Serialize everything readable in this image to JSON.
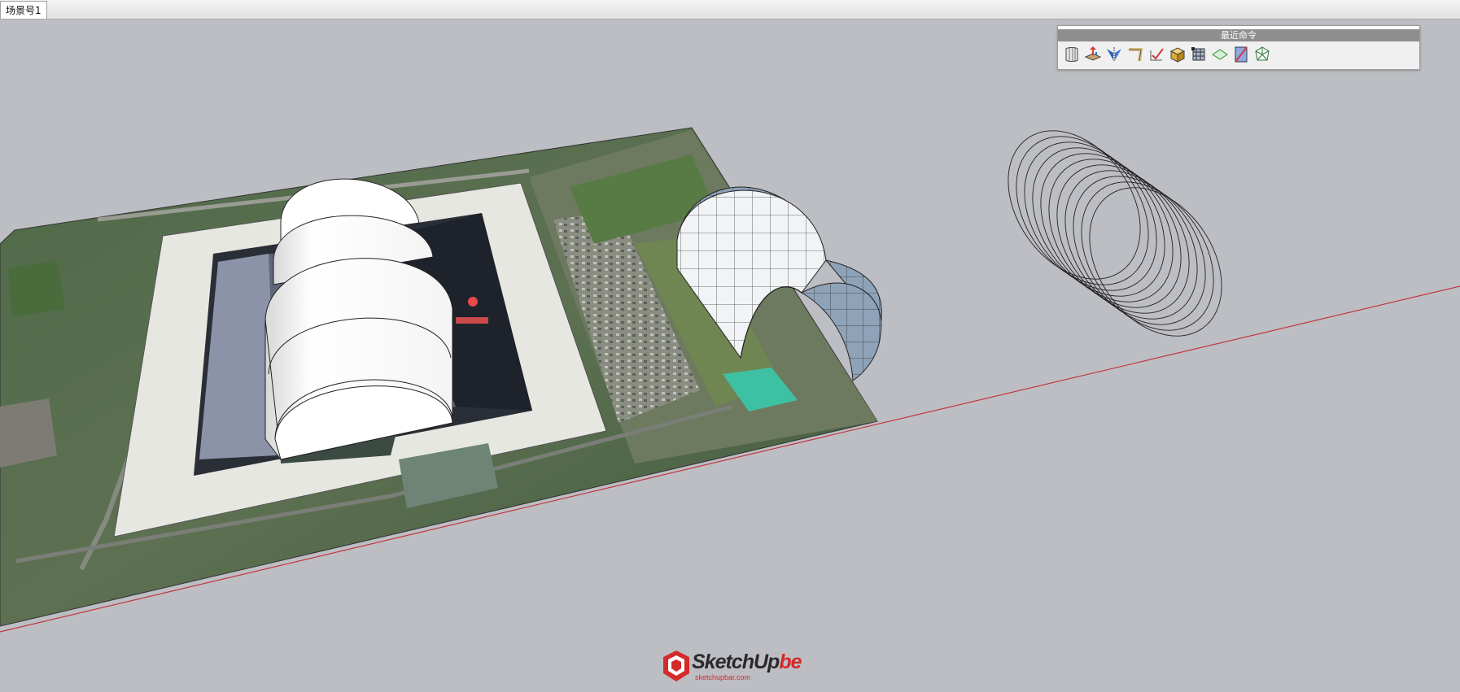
{
  "scene_tabs": [
    {
      "label": "场景号1",
      "active": true
    }
  ],
  "toolbar": {
    "title": "最近命令",
    "buttons": [
      {
        "name": "shell-extrude-icon"
      },
      {
        "name": "push-pull-icon"
      },
      {
        "name": "mirror-icon"
      },
      {
        "name": "bend-icon"
      },
      {
        "name": "check-edges-icon"
      },
      {
        "name": "box-solid-icon"
      },
      {
        "name": "mesh-grid-icon"
      },
      {
        "name": "face-flat-icon"
      },
      {
        "name": "slice-plane-icon"
      },
      {
        "name": "wire-solid-icon"
      }
    ]
  },
  "colors": {
    "background": "#bdbec3",
    "red_axis": "#c0383f",
    "toolbar_title_bg": "#8e8e8e",
    "brand_red": "#d42a2a"
  },
  "watermark": {
    "brand": "SketchUp",
    "suffix": "be",
    "url": "sketchupbar.com"
  }
}
